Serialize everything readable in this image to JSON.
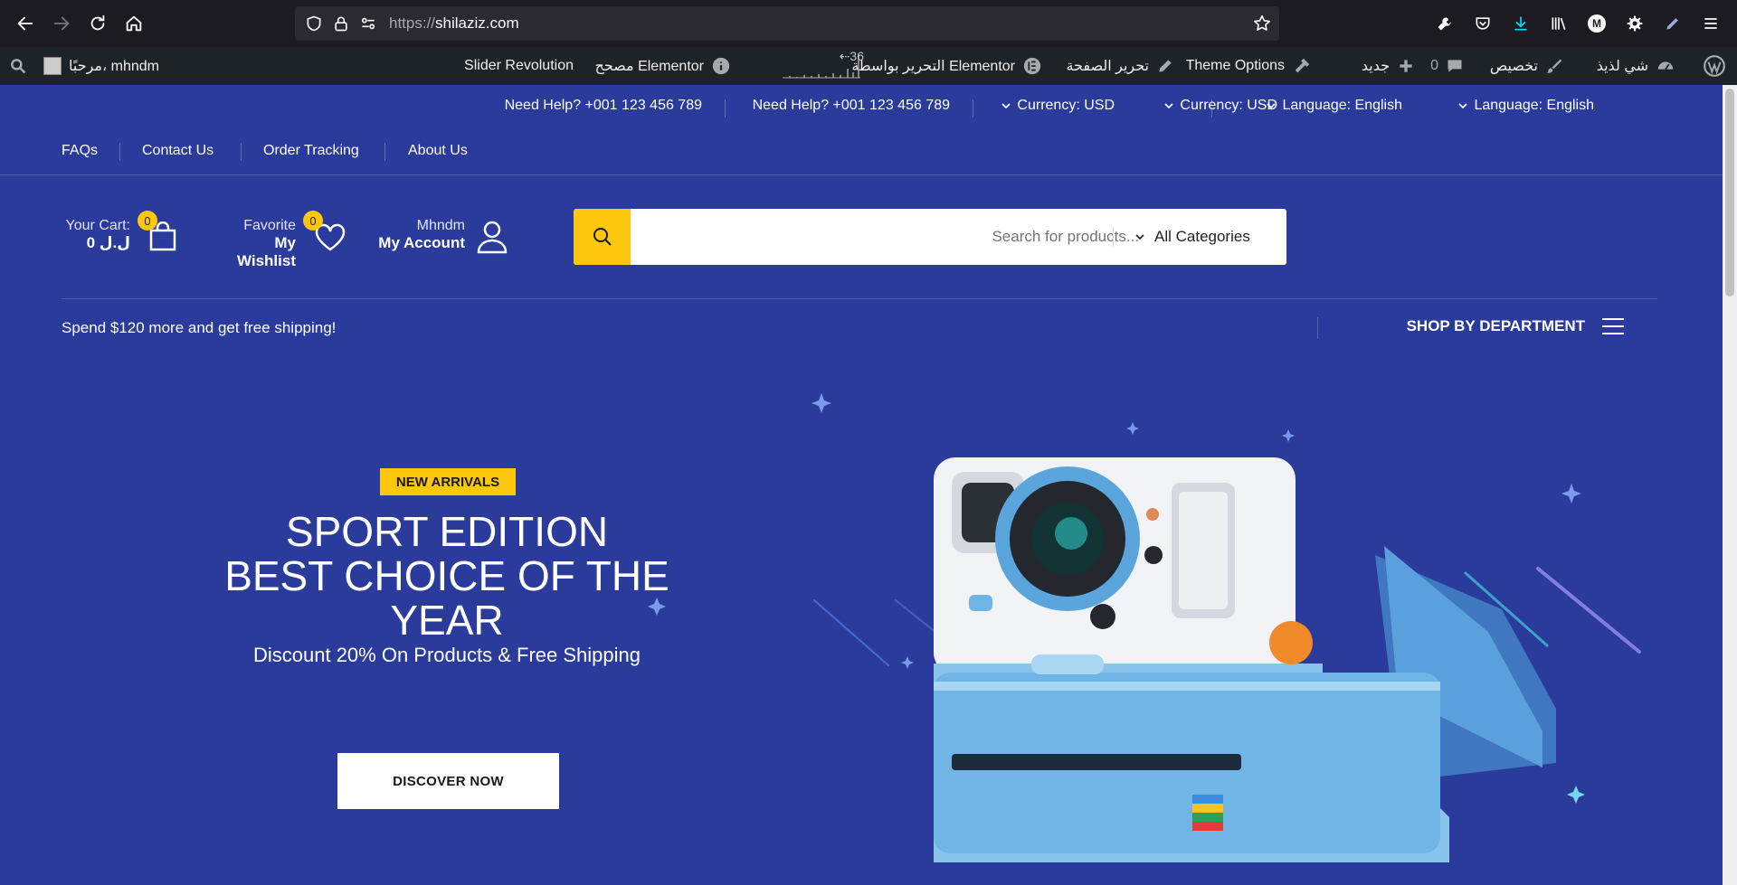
{
  "browser": {
    "url_scheme": "https://",
    "url_host": "shilaziz.com"
  },
  "admin_bar": {
    "site_name": "شي لذيذ",
    "customize": "تخصيص",
    "comments_count": "0",
    "new": "جديد",
    "theme_options": "Theme Options",
    "edit_page": "تحرير الصفحة",
    "edit_with_elementor": "التحرير بواسطة Elementor",
    "stats_count": "36",
    "elementor_debugger": "مصحح Elementor",
    "slider_revolution": "Slider Revolution",
    "greeting": "مرحبًا، mhndm"
  },
  "topbar": {
    "help_1": "Need Help? +001 123 456 789",
    "help_2": "Need Help? +001 123 456 789",
    "currency_1": "Currency: USD",
    "currency_2": "Currency: USD",
    "language_1": "Language: English",
    "language_2": "Language: English"
  },
  "links": {
    "faqs": "FAQs",
    "contact": "Contact Us",
    "tracking": "Order Tracking",
    "about": "About Us"
  },
  "header": {
    "cart_label": "Your Cart:",
    "cart_total": "0 ل.ل",
    "cart_count": "0",
    "wishlist_small": "Favorite",
    "wishlist_big": "My Wishlist",
    "wishlist_count": "0",
    "account_small": "Mhndm",
    "account_big": "My Account",
    "search_placeholder": "Search for products...",
    "category": "All Categories"
  },
  "dept": {
    "shipping": "Spend $120 more and get free shipping!",
    "label": "SHOP BY DEPARTMENT"
  },
  "hero": {
    "tag": "NEW ARRIVALS",
    "line1": "SPORT EDITION",
    "line2": "BEST CHOICE OF THE YEAR",
    "subtitle": "Discount 20% On Products & Free Shipping",
    "cta": "DISCOVER NOW"
  },
  "colors": {
    "brand_blue": "#2a3b9c",
    "accent_yellow": "#fcc70c"
  }
}
